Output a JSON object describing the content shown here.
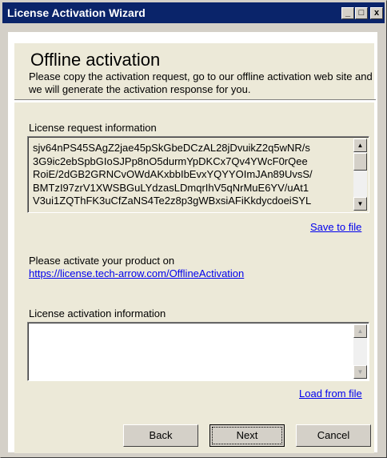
{
  "window": {
    "title": "License Activation Wizard",
    "controls": {
      "minimize": "_",
      "maximize": "□",
      "close": "x"
    }
  },
  "header": {
    "title": "Offline activation",
    "description": "Please copy the activation request, go to our offline activation web site and we will generate the activation response for you."
  },
  "request": {
    "label": "License request information",
    "lines": [
      "sjv64nPS45SAgZ2jae45pSkGbeDCzAL28jDvuikZ2q5wNR/s",
      "3G9ic2ebSpbGIoSJPp8nO5durmYpDKCx7Qv4YWcF0rQee",
      "RoiE/2dGB2GRNCvOWdAKxbbIbEvxYQYYOImJAn89UvsS/",
      "BMTzI97zrV1XWSBGuLYdzasLDmqrIhV5qNrMuE6YV/uAt1",
      "V3ui1ZQThFK3uCfZaNS4Te2z8p3gWBxsiAFiKkdycdoeiSYL"
    ],
    "save_link": "Save to file"
  },
  "activate": {
    "text": "Please activate your product on",
    "url": "https://license.tech-arrow.com/OfflineActivation"
  },
  "response": {
    "label": "License activation information",
    "value": "",
    "load_link": "Load from file"
  },
  "buttons": {
    "back": "Back",
    "next": "Next",
    "cancel": "Cancel"
  },
  "colors": {
    "titlebar": "#0a246a",
    "panel": "#ece9d8",
    "link": "#0000ee"
  },
  "icons": {
    "scroll_up": "scroll-up-arrow-icon",
    "scroll_down": "scroll-down-arrow-icon"
  }
}
